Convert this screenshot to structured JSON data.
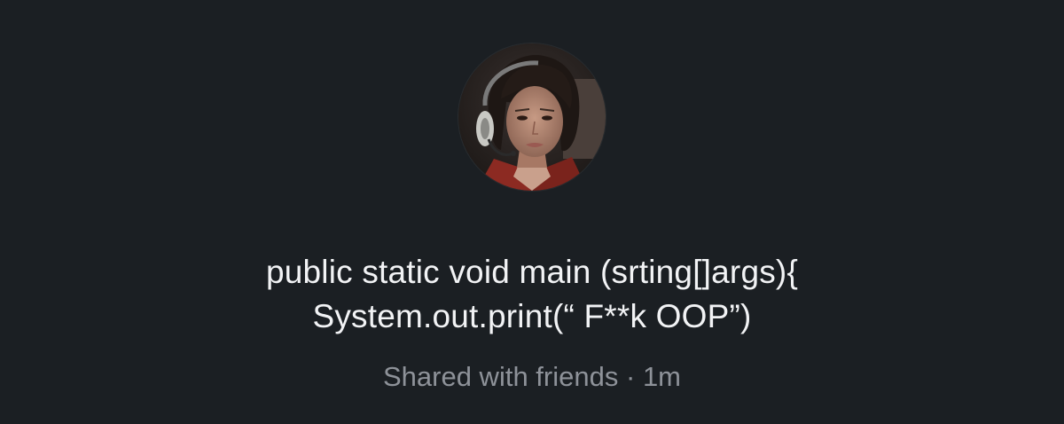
{
  "colors": {
    "background": "#1b1f23",
    "primary_text": "#f2f3f5",
    "secondary_text": "#8e9299"
  },
  "avatar": {
    "icon": "profile-photo"
  },
  "note": {
    "lines": [
      "public static void main (srting[]args){",
      "System.out.print(“ F**k OOP”)"
    ]
  },
  "meta": {
    "audience": "Shared with friends",
    "separator": "·",
    "time": "1m"
  }
}
